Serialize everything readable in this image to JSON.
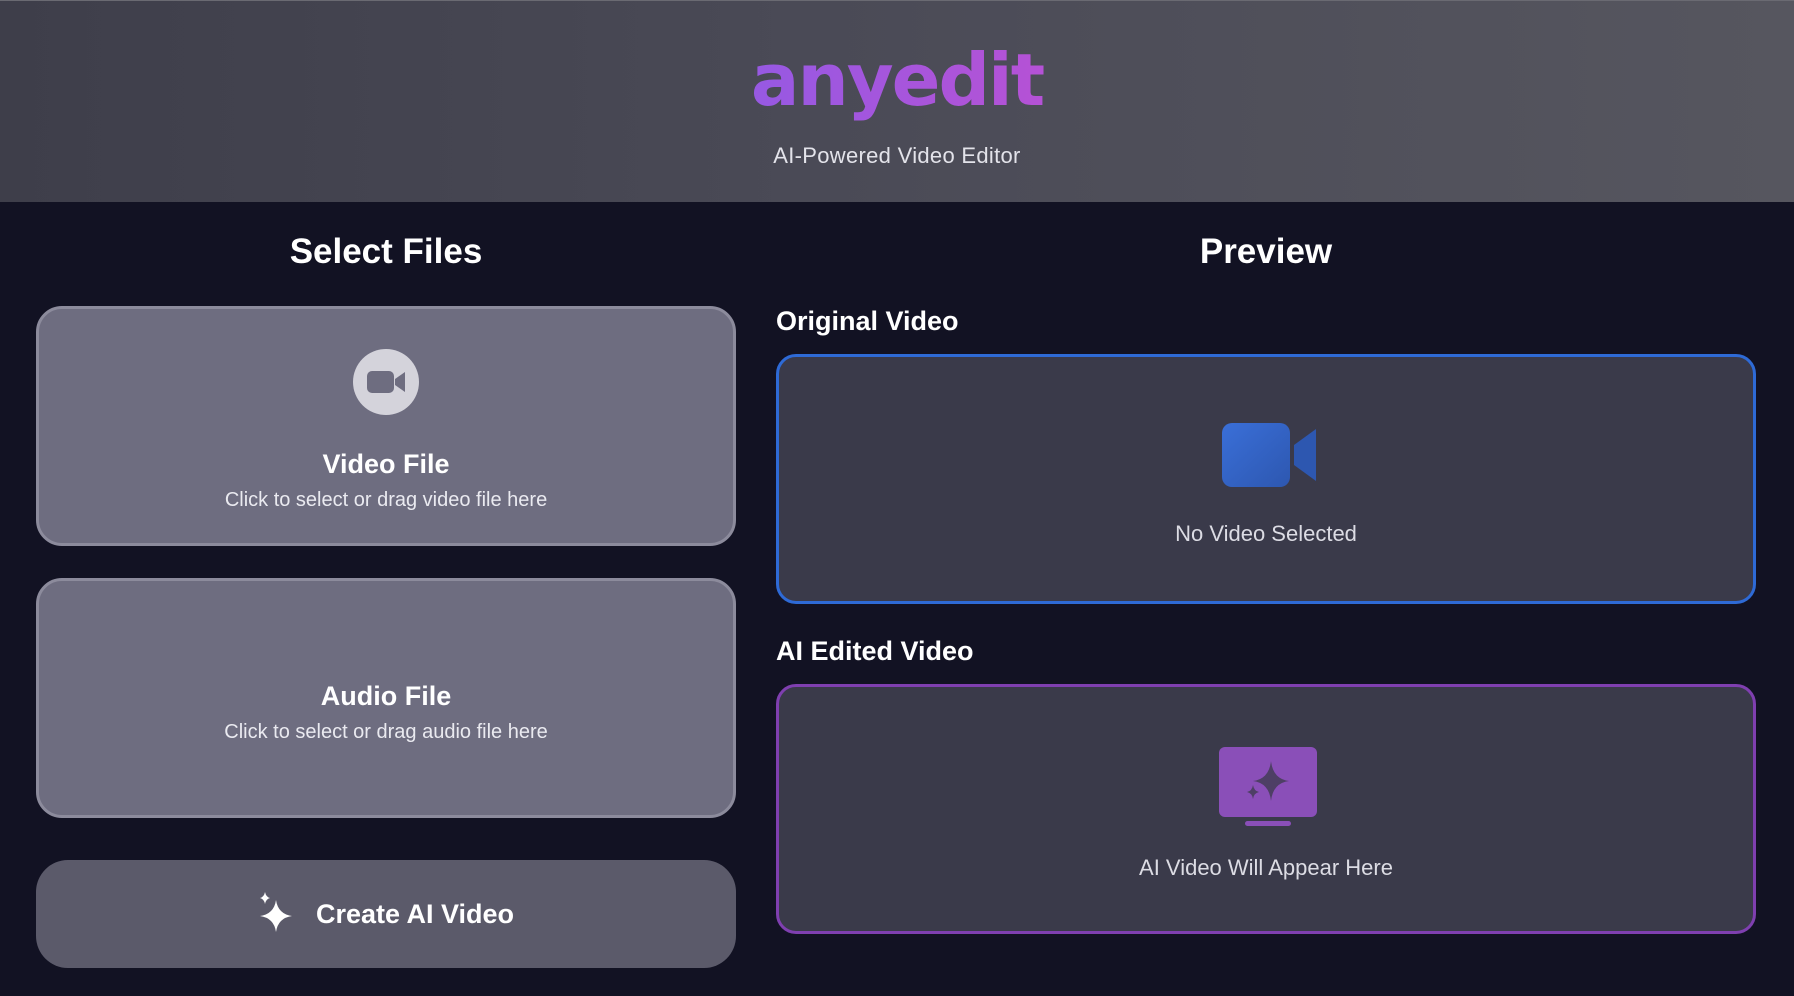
{
  "header": {
    "logo_text": "anyedit",
    "subtitle": "AI-Powered Video Editor"
  },
  "left": {
    "title": "Select Files",
    "video_card": {
      "icon": "video-camera-icon",
      "title": "Video File",
      "description": "Click to select or drag video file here"
    },
    "audio_card": {
      "title": "Audio File",
      "description": "Click to select or drag audio file here"
    },
    "create_button": {
      "icon": "sparkles-icon",
      "label": "Create AI Video"
    }
  },
  "preview": {
    "title": "Preview",
    "original": {
      "label": "Original Video",
      "icon": "video-camera-icon",
      "placeholder": "No Video Selected"
    },
    "edited": {
      "label": "AI Edited Video",
      "icon": "ai-monitor-icon",
      "placeholder": "AI Video Will Appear Here"
    }
  },
  "colors": {
    "background": "#121223",
    "card": "#6e6d80",
    "button": "#5b5a6a",
    "original_border": "#2e6ad6",
    "edited_border": "#7f3fb0",
    "logo_gradient_start": "#4f6cf5",
    "logo_gradient_end": "#ee4460"
  }
}
